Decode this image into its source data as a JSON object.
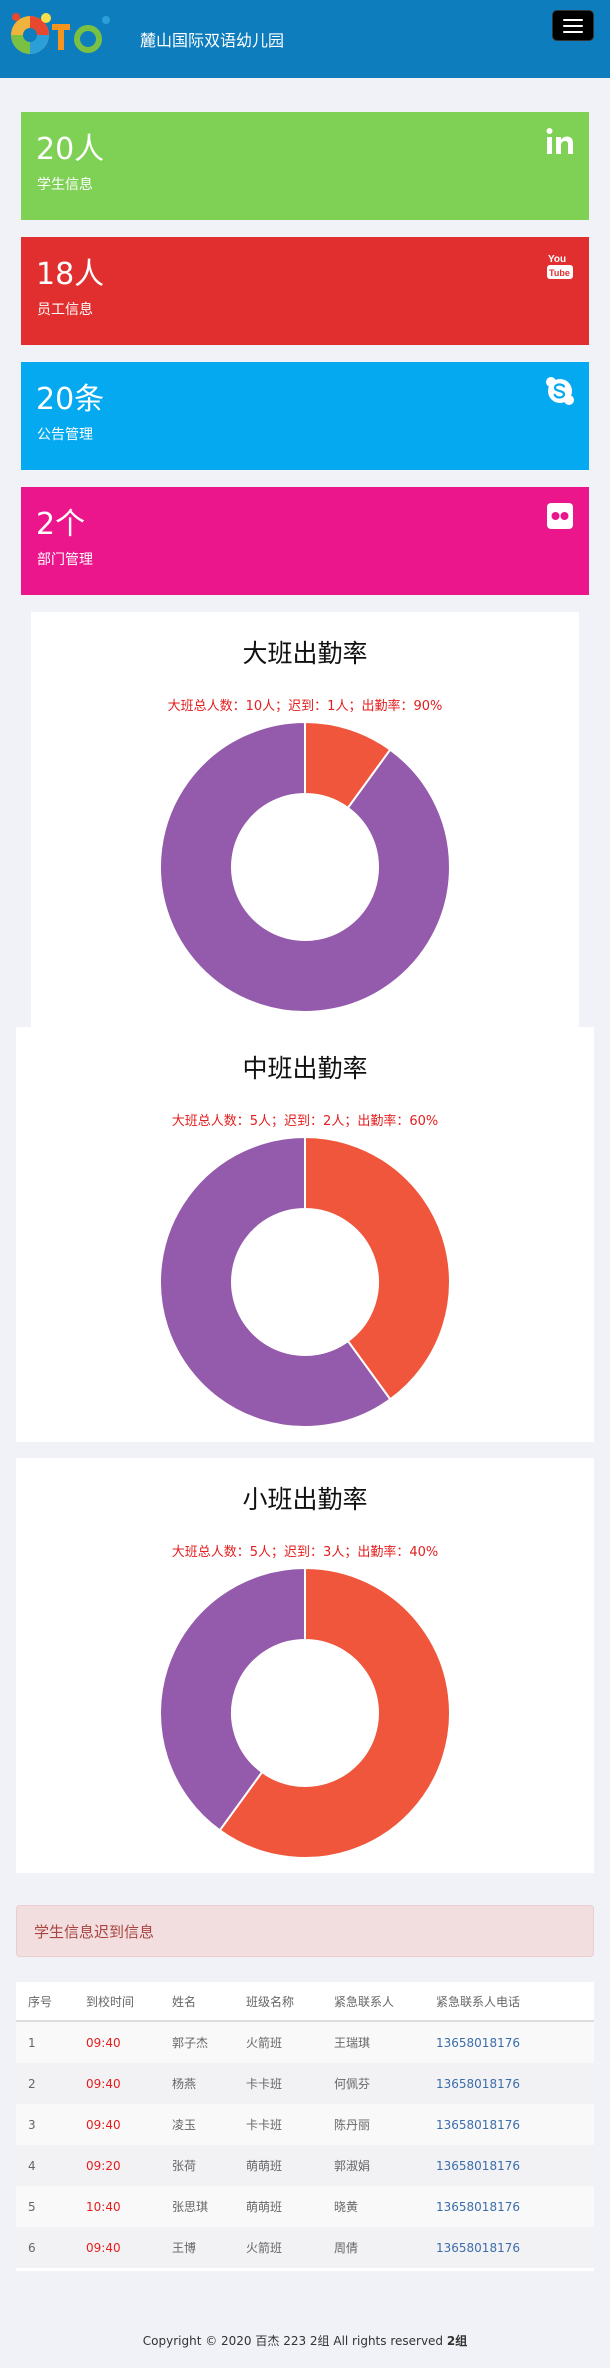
{
  "header": {
    "brand_title": "麓山国际双语幼儿园",
    "logo_text": "to"
  },
  "stats": [
    {
      "count": "20人",
      "label": "学生信息",
      "color": "#7ed154",
      "icon": "linkedin-icon"
    },
    {
      "count": "18人",
      "label": "员工信息",
      "color": "#e12f2f",
      "icon": "youtube-icon"
    },
    {
      "count": "20条",
      "label": "公告管理",
      "color": "#05a9ef",
      "icon": "skype-icon"
    },
    {
      "count": "2个",
      "label": "部门管理",
      "color": "#ec168c",
      "icon": "flickr-icon"
    }
  ],
  "chart_data": [
    {
      "type": "pie",
      "title": "大班出勤率",
      "subtitle": "大班总人数：10人；迟到：1人；出勤率：90%",
      "categories": [
        "迟到",
        "出勤"
      ],
      "values": [
        1,
        9
      ],
      "colors": [
        "#ef563b",
        "#945aab"
      ]
    },
    {
      "type": "pie",
      "title": "中班出勤率",
      "subtitle": "大班总人数：5人；迟到：2人；出勤率：60%",
      "categories": [
        "迟到",
        "出勤"
      ],
      "values": [
        2,
        3
      ],
      "colors": [
        "#ef563b",
        "#945aab"
      ]
    },
    {
      "type": "pie",
      "title": "小班出勤率",
      "subtitle": "大班总人数：5人；迟到：3人；出勤率：40%",
      "categories": [
        "迟到",
        "出勤"
      ],
      "values": [
        3,
        2
      ],
      "colors": [
        "#ef563b",
        "#945aab"
      ]
    }
  ],
  "late_panel": {
    "title": "学生信息迟到信息"
  },
  "table": {
    "headers": [
      "序号",
      "到校时间",
      "姓名",
      "班级名称",
      "紧急联系人",
      "紧急联系人电话"
    ],
    "rows": [
      [
        "1",
        "09:40",
        "郭子杰",
        "火箭班",
        "王瑞琪",
        "13658018176"
      ],
      [
        "2",
        "09:40",
        "杨燕",
        "卡卡班",
        "何佩芬",
        "13658018176"
      ],
      [
        "3",
        "09:40",
        "凌玉",
        "卡卡班",
        "陈丹丽",
        "13658018176"
      ],
      [
        "4",
        "09:20",
        "张荷",
        "萌萌班",
        "郭淑娟",
        "13658018176"
      ],
      [
        "5",
        "10:40",
        "张思琪",
        "萌萌班",
        "晓黄",
        "13658018176"
      ],
      [
        "6",
        "09:40",
        "王博",
        "火箭班",
        "周倩",
        "13658018176"
      ]
    ]
  },
  "footer": {
    "text": "Copyright © 2020 百杰 223 2组 All rights reserved ",
    "bold": "2组"
  }
}
